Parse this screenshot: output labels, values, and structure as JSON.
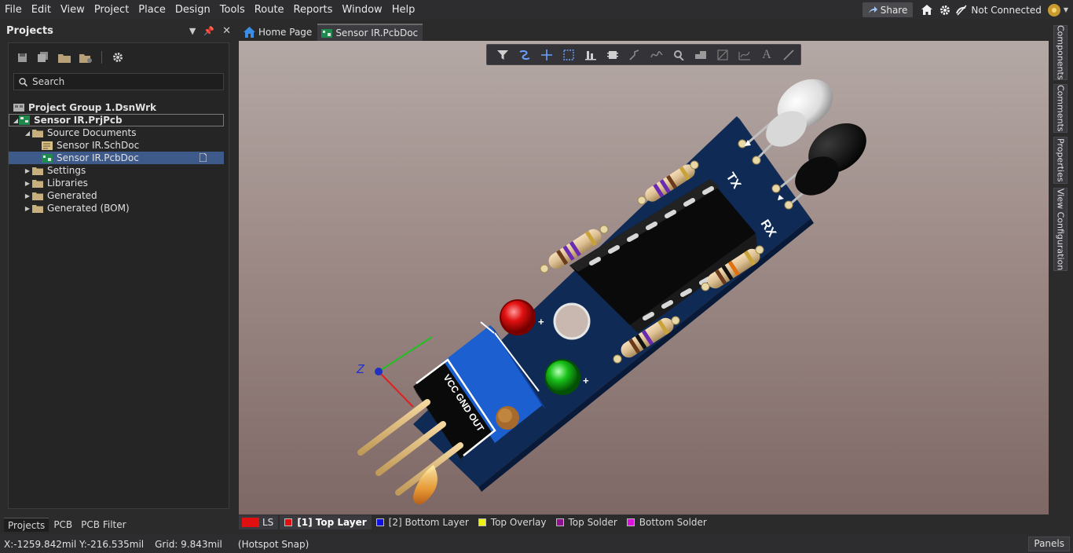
{
  "menu": [
    "File",
    "Edit",
    "View",
    "Project",
    "Place",
    "Design",
    "Tools",
    "Route",
    "Reports",
    "Window",
    "Help"
  ],
  "menubar_right": {
    "share_label": "Share",
    "connection_status": "Not Connected"
  },
  "projects_panel": {
    "title": "Projects",
    "search_placeholder": "Search",
    "tree": {
      "group": "Project Group 1.DsnWrk",
      "project": "Sensor IR.PrjPcb",
      "source_documents": "Source Documents",
      "schdoc": "Sensor IR.SchDoc",
      "pcbdoc": "Sensor IR.PcbDoc",
      "settings": "Settings",
      "libraries": "Libraries",
      "generated": "Generated",
      "generated_bom": "Generated (BOM)"
    }
  },
  "panel_tabs": [
    "Projects",
    "PCB",
    "PCB Filter"
  ],
  "doc_tabs": [
    "Home Page",
    "Sensor IR.PcbDoc"
  ],
  "right_panels": [
    "Components",
    "Comments",
    "Properties",
    "View Configuration"
  ],
  "layers": {
    "ls_label": "LS",
    "items": [
      {
        "name": "[1] Top Layer",
        "color": "#e01010"
      },
      {
        "name": "[2] Bottom Layer",
        "color": "#1010e0"
      },
      {
        "name": "Top Overlay",
        "color": "#f0f010"
      },
      {
        "name": "Top Solder",
        "color": "#901090"
      },
      {
        "name": "Bottom Solder",
        "color": "#e010e0"
      }
    ]
  },
  "silkscreen": {
    "tx": "TX",
    "rx": "RX",
    "header": "VCC GND OUT",
    "axis_z": "Z"
  },
  "status": {
    "coord": "X:-1259.842mil Y:-216.535mil",
    "grid": "Grid: 9.843mil",
    "snap": "(Hotspot Snap)",
    "panels_button": "Panels"
  },
  "colors": {
    "accent": "#3e5a8a",
    "board": "#0e2a55",
    "ui_bg": "#2b2b2b"
  }
}
